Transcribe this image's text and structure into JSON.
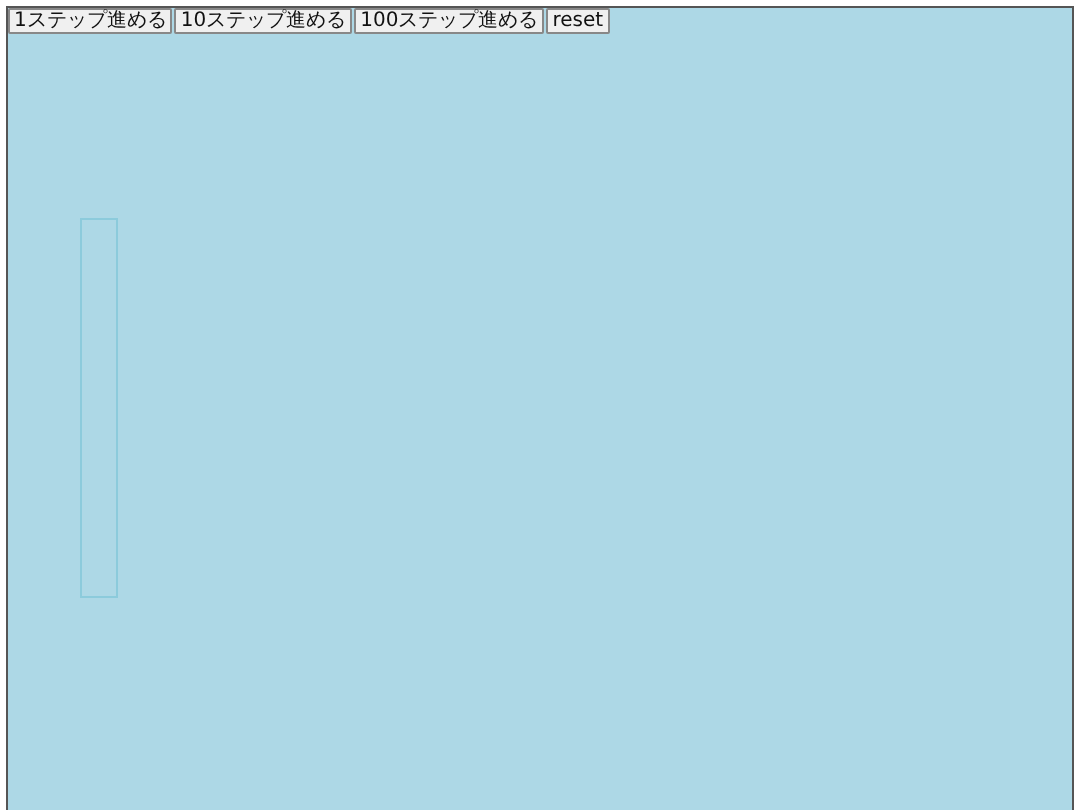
{
  "toolbar": {
    "buttons": [
      "1ステップ進める",
      "10ステップ進める",
      "100ステップ進める",
      "reset"
    ]
  },
  "canvas": {
    "items": [
      {
        "kind": "frame"
      }
    ]
  }
}
